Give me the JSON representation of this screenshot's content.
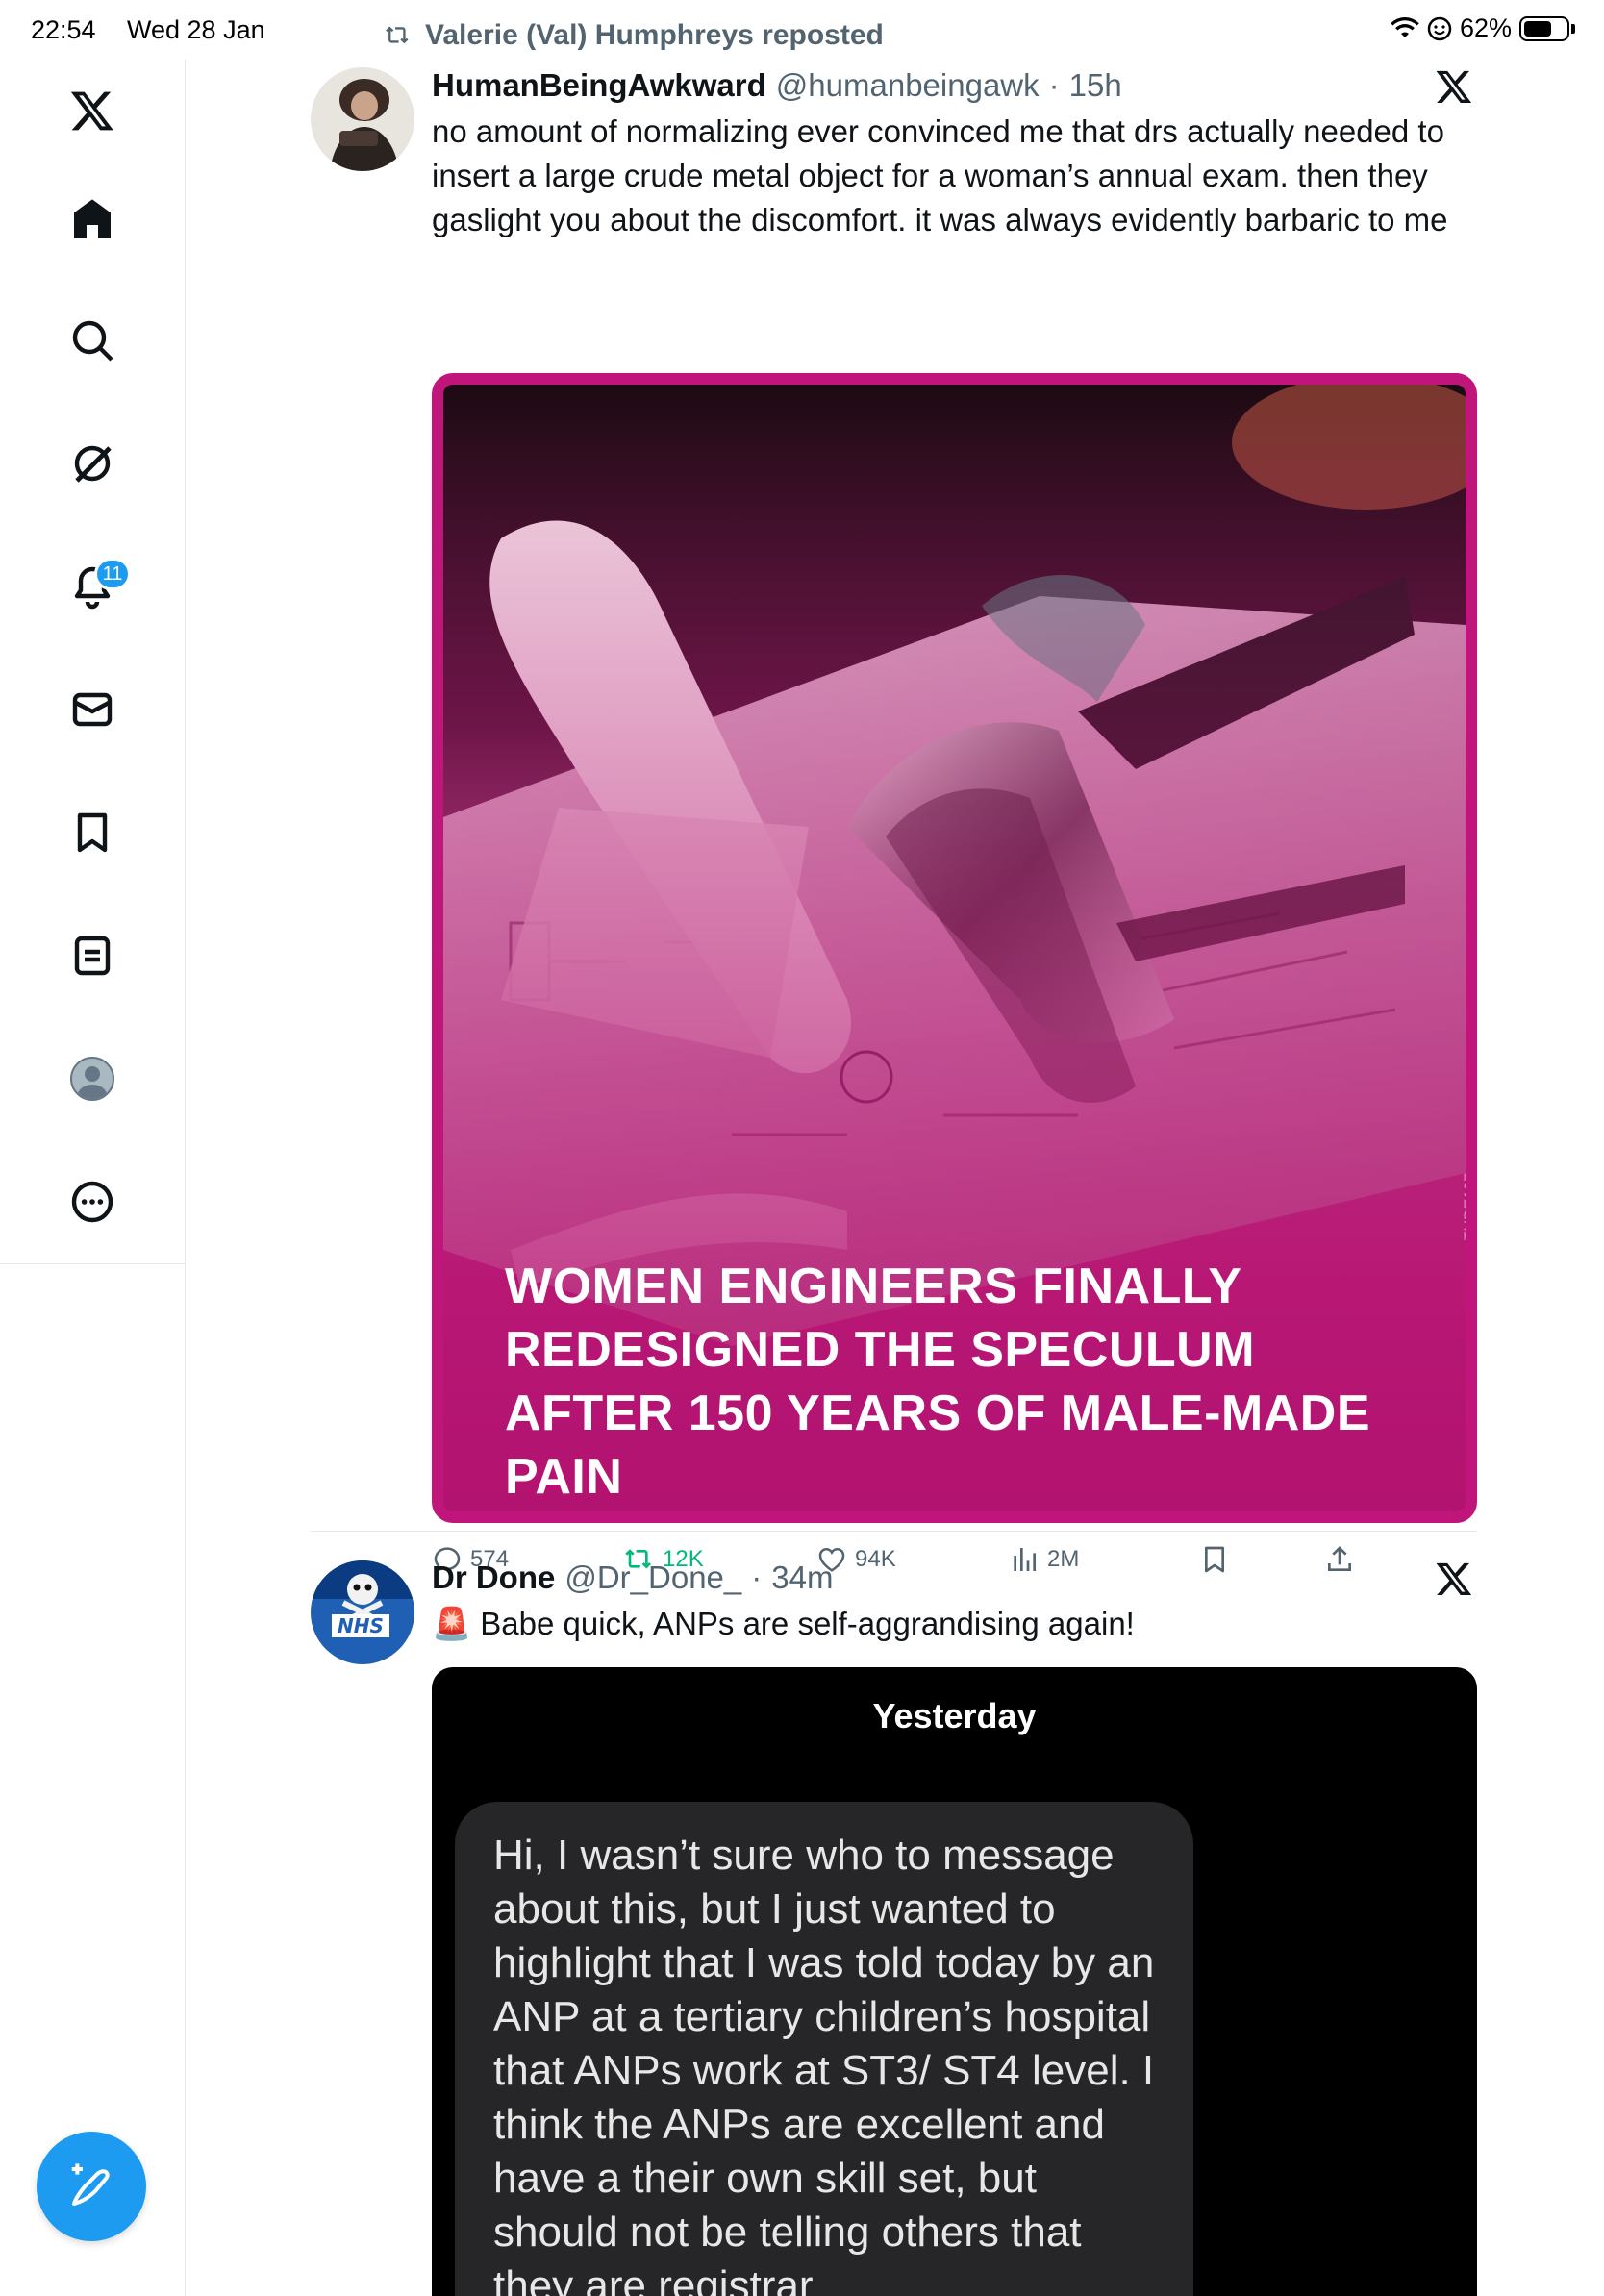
{
  "status_bar": {
    "time": "22:54",
    "date": "Wed 28 Jan",
    "battery": "62%"
  },
  "sidebar": {
    "items": [
      {
        "name": "x-logo-icon"
      },
      {
        "name": "home-icon"
      },
      {
        "name": "search-icon"
      },
      {
        "name": "grok-icon"
      },
      {
        "name": "notifications-icon",
        "badge": "11"
      },
      {
        "name": "messages-icon"
      },
      {
        "name": "bookmarks-icon"
      },
      {
        "name": "lists-icon"
      },
      {
        "name": "profile-avatar"
      },
      {
        "name": "more-icon"
      }
    ],
    "compose_button": "compose-icon"
  },
  "feed": {
    "repost_label": "Valerie (Val) Humphreys reposted",
    "tweets": [
      {
        "author_name": "HumanBeingAwkward",
        "handle": "@humanbeingawk",
        "dot": "·",
        "time": "15h",
        "text": "no amount of normalizing ever convinced me that drs actually needed to insert a large crude metal object for a woman’s annual exam. then they gaslight you about the discomfort. it was always evidently barbaric to me",
        "media_headline": "WOMEN ENGINEERS FINALLY REDESIGNED THE SPECULUM AFTER 150 YEARS OF MALE-MADE PAIN",
        "media_watermark": "TUDE107",
        "actions": {
          "replies": "574",
          "reposts": "12K",
          "likes": "94K",
          "views": "2M"
        }
      },
      {
        "author_name": "Dr Done",
        "handle": "@Dr_Done_",
        "dot": "·",
        "time": "34m",
        "emoji": "🚨",
        "text": "Babe quick, ANPs are self-aggrandising again!",
        "chat": {
          "date_label": "Yesterday",
          "message": "Hi, I wasn’t sure who to message about this, but I just wanted to highlight that I was told today by an ANP at a tertiary children’s hospital that ANPs work at ST3/ ST4 level. I think the ANPs are excellent and have a their own skill set, but should not be telling others that they are registrar"
        }
      }
    ]
  },
  "colors": {
    "accent": "#1d9bf0",
    "repost_green": "#00ba7c",
    "secondary_text": "#536471",
    "media_magenta": "#c0157a"
  }
}
